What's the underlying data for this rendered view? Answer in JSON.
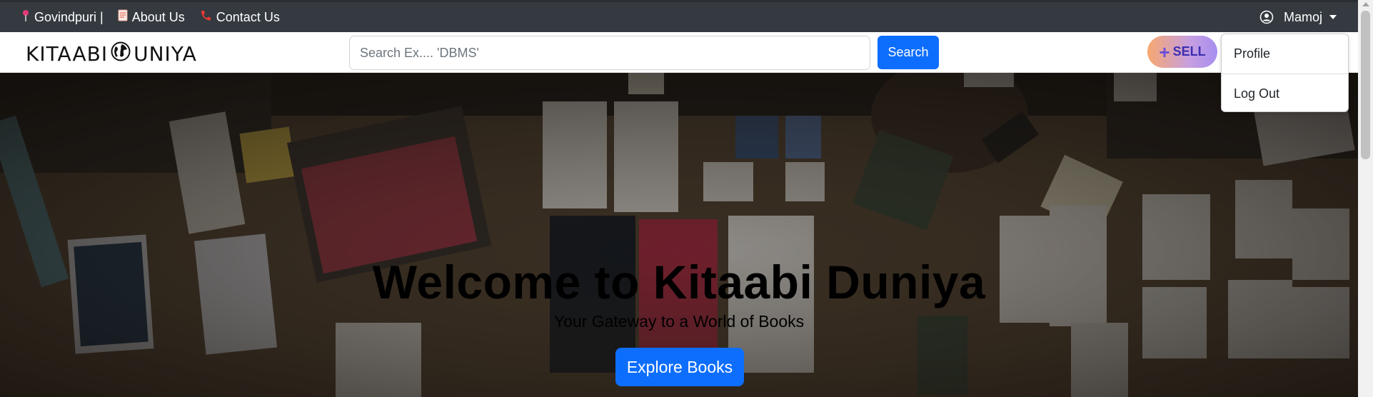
{
  "topbar": {
    "location": "Govindpuri |",
    "about": "About Us",
    "contact": "Contact Us",
    "user": "Mamoj"
  },
  "navbar": {
    "logo_left": "KITAABI",
    "logo_right": "UNIYA",
    "search_placeholder": "Search Ex.... 'DBMS'",
    "search_button": "Search",
    "sell_button": "SELL"
  },
  "dropdown": {
    "items": [
      "Profile",
      "Log Out"
    ]
  },
  "hero": {
    "title": "Welcome to Kitaabi Duniya",
    "subtitle": "Your Gateway to a World of Books",
    "button": "Explore Books"
  },
  "icons": {
    "location": "map-pin-icon",
    "about": "document-icon",
    "contact": "phone-icon",
    "user": "user-circle-icon",
    "logo": "globe-icon"
  },
  "colors": {
    "topbar_bg": "#343a40",
    "primary": "#0d6efd"
  }
}
